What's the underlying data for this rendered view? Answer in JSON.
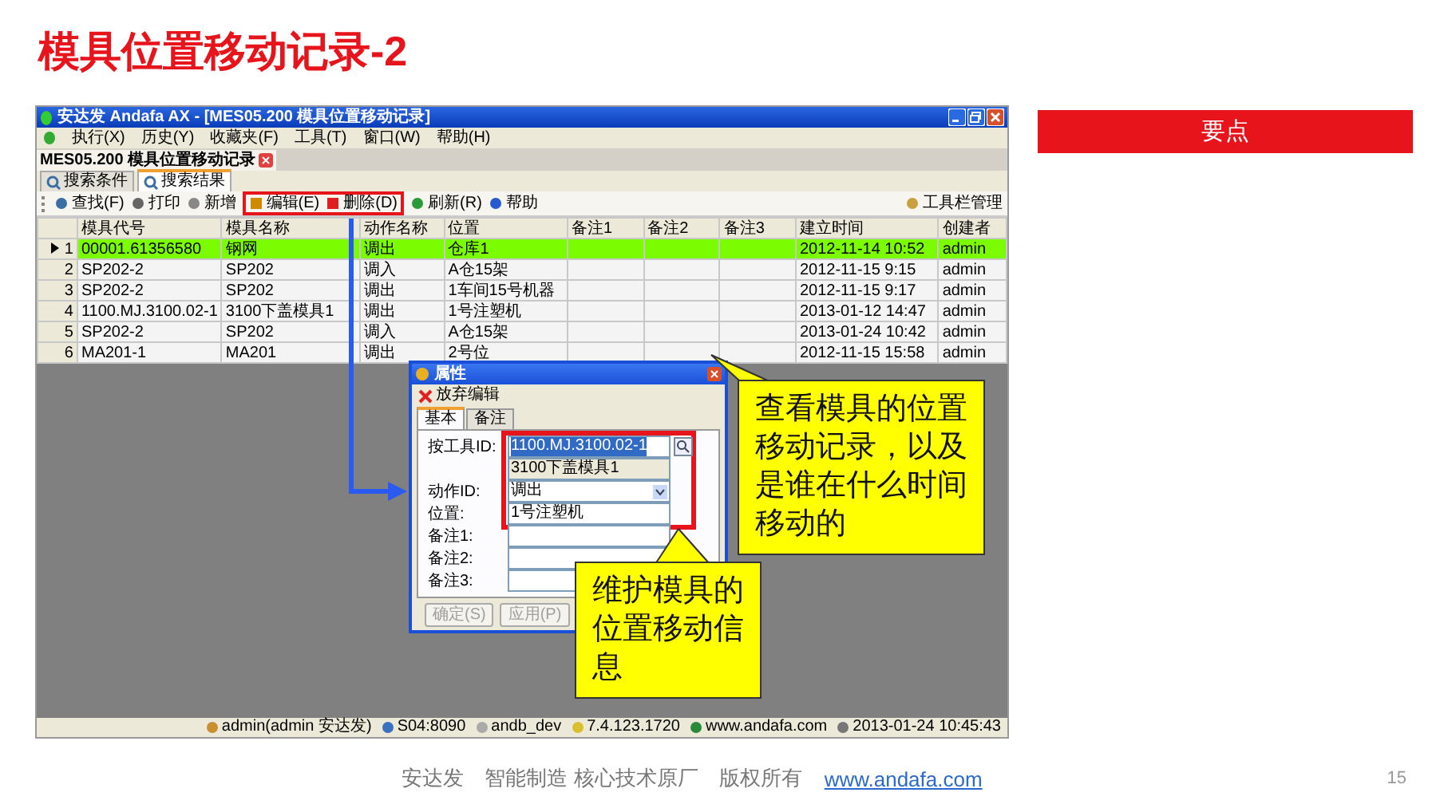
{
  "title": "模具位置移动记录-2",
  "app": {
    "window_title": "安达发 Andafa AX - [MES05.200 模具位置移动记录]",
    "menu": [
      "执行(X)",
      "历史(Y)",
      "收藏夹(F)",
      "工具(T)",
      "窗口(W)",
      "帮助(H)"
    ],
    "document_tab": "MES05.200 模具位置移动记录",
    "tabs": [
      {
        "label": "搜索条件",
        "selected": false
      },
      {
        "label": "搜索结果",
        "selected": true
      }
    ],
    "toolbar": [
      {
        "label": "查找(F)",
        "kind": "find",
        "highlighted": false
      },
      {
        "label": "打印",
        "kind": "print",
        "highlighted": false
      },
      {
        "label": "新增",
        "kind": "new",
        "highlighted": false
      },
      {
        "label": "编辑(E)",
        "kind": "edit",
        "highlighted": true
      },
      {
        "label": "删除(D)",
        "kind": "delete",
        "highlighted": true
      },
      {
        "label": "刷新(R)",
        "kind": "refresh",
        "highlighted": false
      },
      {
        "label": "帮助",
        "kind": "help",
        "highlighted": false
      }
    ],
    "toolbar_manager": "工具栏管理",
    "table": {
      "columns": [
        "模具代号",
        "模具名称",
        "动作名称",
        "位置",
        "备注1",
        "备注2",
        "备注3",
        "建立时间",
        "创建者"
      ],
      "rows": [
        {
          "number": "1",
          "selected": true,
          "cells": [
            "00001.61356580",
            "钢网",
            "调出",
            "仓库1",
            null,
            null,
            null,
            "2012-11-14 10:52",
            "admin"
          ]
        },
        {
          "number": "2",
          "selected": false,
          "cells": [
            "SP202-2",
            "SP202",
            "调入",
            "A仓15架",
            null,
            null,
            null,
            "2012-11-15 9:15",
            "admin"
          ]
        },
        {
          "number": "3",
          "selected": false,
          "cells": [
            "SP202-2",
            "SP202",
            "调出",
            "1车间15号机器",
            null,
            null,
            null,
            "2012-11-15 9:17",
            "admin"
          ]
        },
        {
          "number": "4",
          "selected": false,
          "cells": [
            "1100.MJ.3100.02-1",
            "3100下盖模具1",
            "调出",
            "1号注塑机",
            null,
            null,
            null,
            "2013-01-12 14:47",
            "admin"
          ]
        },
        {
          "number": "5",
          "selected": false,
          "cells": [
            "SP202-2",
            "SP202",
            "调入",
            "A仓15架",
            null,
            null,
            null,
            "2013-01-24 10:42",
            "admin"
          ]
        },
        {
          "number": "6",
          "selected": false,
          "cells": [
            "MA201-1",
            "MA201",
            "调出",
            "2号位",
            null,
            null,
            null,
            "2012-11-15 15:58",
            "admin"
          ]
        }
      ]
    },
    "status_bar": [
      {
        "text": "admin(admin 安达发)",
        "kind": "user"
      },
      {
        "text": "S04:8090",
        "kind": "server"
      },
      {
        "text": "andb_dev",
        "kind": "database"
      },
      {
        "text": "7.4.123.1720",
        "kind": "version"
      },
      {
        "text": "www.andafa.com",
        "kind": "web"
      },
      {
        "text": "2013-01-24 10:45:43",
        "kind": "clock"
      }
    ]
  },
  "dialog": {
    "title": "属性",
    "toolbar": "放弃编辑",
    "tabs": [
      {
        "label": "基本",
        "selected": true
      },
      {
        "label": "备注",
        "selected": false
      }
    ],
    "fields": [
      {
        "label": "按工具ID:",
        "value": "1100.MJ.3100.02-1",
        "kind": "lookup"
      },
      {
        "value": "3100下盖模具1",
        "kind": "readonly"
      },
      {
        "label": "动作ID:",
        "value": "调出",
        "kind": "select"
      },
      {
        "label": "位置:",
        "value": "1号注塑机",
        "kind": "text"
      },
      {
        "label": "备注1:",
        "kind": "text"
      },
      {
        "label": "备注2:",
        "kind": "text"
      },
      {
        "label": "备注3:",
        "kind": "text"
      }
    ],
    "buttons": [
      {
        "label": "确定(S)",
        "disabled": true
      },
      {
        "label": "应用(P)",
        "disabled": true
      }
    ]
  },
  "callouts": [
    "查看模具的位置移动记录，以及是谁在什么时间移动的",
    "维护模具的位置移动信息"
  ],
  "banner": "要点",
  "footer": {
    "text": "安达发　智能制造 核心技术原厂　版权所有",
    "link": "www.andafa.com",
    "page": "15"
  }
}
